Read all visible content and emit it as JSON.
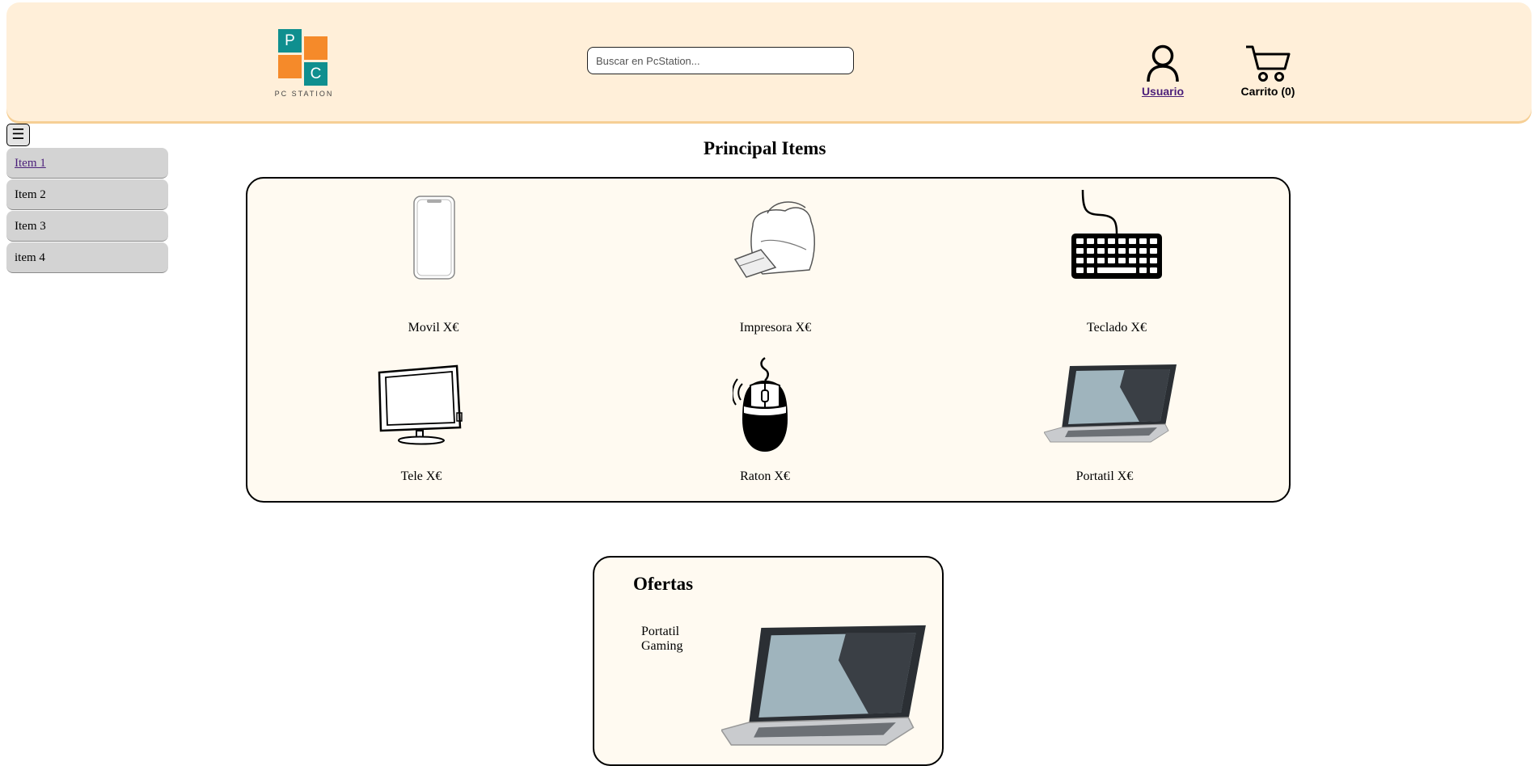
{
  "header": {
    "logo_letters": [
      "P",
      "C"
    ],
    "logo_caption": "PC STATION",
    "search_placeholder": "Buscar en PcStation...",
    "user_label": "Usuario",
    "cart_label": "Carrito (0)"
  },
  "colors": {
    "header_bg": "#ffefd9",
    "logo_teal": "#0f8f8f",
    "logo_orange": "#f58a2a",
    "panel_bg": "#fffaf1",
    "sidebar_item_bg": "#d3d3d3",
    "link": "#4b1f7a"
  },
  "sidebar": {
    "toggle_icon": "☰",
    "items": [
      {
        "label": "Item 1",
        "active_link": true
      },
      {
        "label": "Item 2"
      },
      {
        "label": "Item 3"
      },
      {
        "label": "item 4"
      }
    ]
  },
  "principal": {
    "title": "Principal Items",
    "products": [
      {
        "name": "Movil X€",
        "icon": "phone-icon"
      },
      {
        "name": "Impresora X€",
        "icon": "printer-icon"
      },
      {
        "name": "Teclado X€",
        "icon": "keyboard-icon"
      },
      {
        "name": "Tele X€",
        "icon": "monitor-icon"
      },
      {
        "name": "Raton X€",
        "icon": "mouse-icon"
      },
      {
        "name": "Portatil X€",
        "icon": "laptop-icon"
      }
    ]
  },
  "ofertas": {
    "title": "Ofertas",
    "item_name": "Portatil Gaming",
    "item_icon": "laptop-icon"
  }
}
